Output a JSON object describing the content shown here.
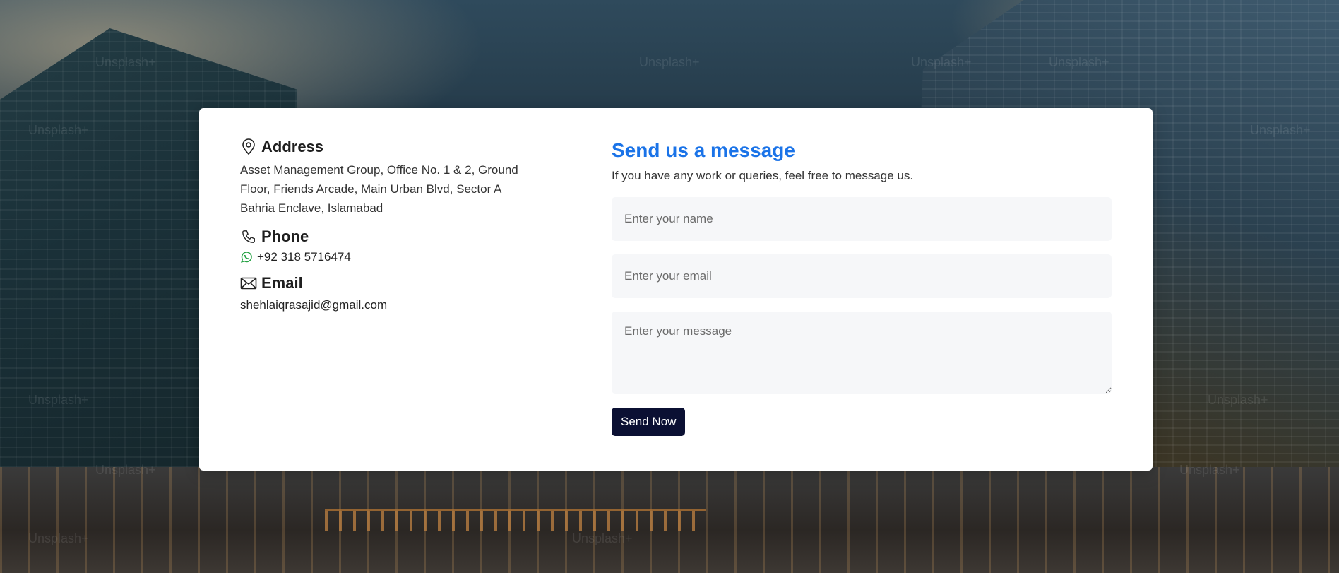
{
  "contact": {
    "address_heading": "Address",
    "address_text": "Asset Management Group, Office No. 1 & 2, Ground Floor, Friends Arcade, Main Urban Blvd, Sector A Bahria Enclave, Islamabad",
    "phone_heading": "Phone",
    "phone_number": "+92 318 5716474",
    "email_heading": "Email",
    "email_address": "shehlaiqrasajid@gmail.com",
    "icons": {
      "address": "location-pin-icon",
      "phone": "phone-icon",
      "whatsapp": "whatsapp-icon",
      "email": "envelope-icon"
    }
  },
  "form": {
    "title": "Send us a message",
    "subtitle": "If you have any work or queries, feel free to message us.",
    "name_placeholder": "Enter your name",
    "email_placeholder": "Enter your email",
    "message_placeholder": "Enter your message",
    "submit_label": "Send Now"
  },
  "background": {
    "watermark": "Unsplash+"
  },
  "colors": {
    "title_accent": "#1a73e8",
    "button_bg": "#0b1033",
    "whatsapp": "#25a244"
  }
}
